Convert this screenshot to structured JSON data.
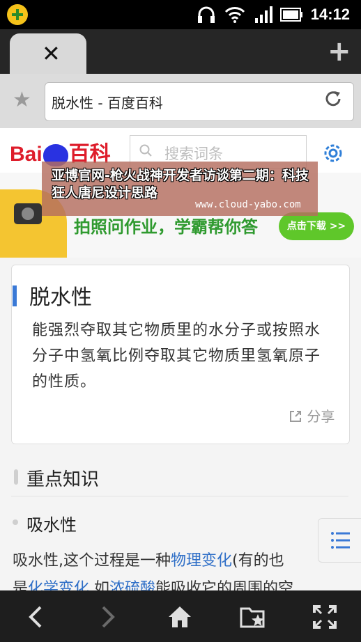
{
  "status_bar": {
    "time": "14:12"
  },
  "browser": {
    "tab_close_glyph": "✕",
    "new_tab_glyph": "+",
    "address": "脱水性 - 百度百科"
  },
  "header": {
    "logo_left": "Bai",
    "logo_mid": "du",
    "logo_right": "百科",
    "search_placeholder": "搜索词条"
  },
  "banner": {
    "text": "拍照问作业，学霸帮你答",
    "button": "点击下载 >>"
  },
  "watermark": {
    "title": "亚博官网-枪火战神开发者访谈第二期：科技狂人唐尼设计思路",
    "url": "www.cloud-yabo.com"
  },
  "card": {
    "title": "脱水性",
    "body": "能强烈夺取其它物质里的水分子或按照水分子中氢氧比例夺取其它物质里氢氧原子的性质。",
    "share": "分享"
  },
  "section": {
    "title": "重点知识",
    "subtitle": "吸水性",
    "line1_a": "吸水性,这个过程是一种",
    "line1_link": "物理变化",
    "line1_b": "(有的也",
    "line2_a": "是",
    "line2_link1": "化学变化",
    "line2_b": ",如",
    "line2_link2": "浓硫酸",
    "line2_c": "能吸收它的周围的空"
  },
  "colors": {
    "accent_blue": "#3a79d6",
    "link": "#2f6fc7",
    "baidu_red": "#de1d2b",
    "baidu_blue": "#2932e1"
  }
}
